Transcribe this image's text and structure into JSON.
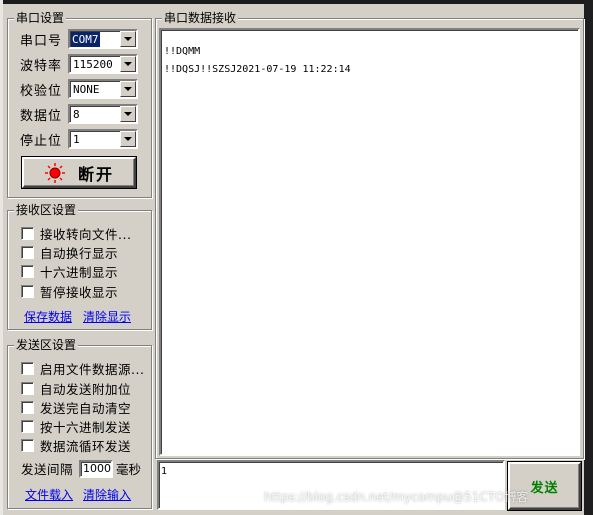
{
  "serial_settings": {
    "title": "串口设置",
    "port": {
      "label": "串口号",
      "value": "COM7"
    },
    "baud": {
      "label": "波特率",
      "value": "115200"
    },
    "parity": {
      "label": "校验位",
      "value": "NONE"
    },
    "databits": {
      "label": "数据位",
      "value": "8"
    },
    "stopbits": {
      "label": "停止位",
      "value": "1"
    },
    "open_button": {
      "label": "断开",
      "indicator_color": "#ff0000"
    }
  },
  "receive_settings": {
    "title": "接收区设置",
    "options": [
      {
        "label": "接收转向文件...",
        "checked": false
      },
      {
        "label": "自动换行显示",
        "checked": false
      },
      {
        "label": "十六进制显示",
        "checked": false
      },
      {
        "label": "暂停接收显示",
        "checked": false
      }
    ],
    "save_link": "保存数据",
    "clear_link": "清除显示"
  },
  "send_settings": {
    "title": "发送区设置",
    "options": [
      {
        "label": "启用文件数据源...",
        "checked": false
      },
      {
        "label": "自动发送附加位",
        "checked": false
      },
      {
        "label": "发送完自动清空",
        "checked": false
      },
      {
        "label": "按十六进制发送",
        "checked": false
      },
      {
        "label": "数据流循环发送",
        "checked": false
      }
    ],
    "interval_label": "发送间隔",
    "interval_value": "1000",
    "interval_unit": "毫秒",
    "load_link": "文件载入",
    "clear_link": "清除输入"
  },
  "receive_area": {
    "title": "串口数据接收",
    "lines": [
      "!!DQMM",
      "!!DQSJ!!SZSJ2021-07-19 11:22:14"
    ]
  },
  "send_area": {
    "input_value": "1",
    "send_button": "发送",
    "send_button_color": "#008000"
  },
  "watermark": "https://blog.csdn.net/mycompu@51CTO博客"
}
